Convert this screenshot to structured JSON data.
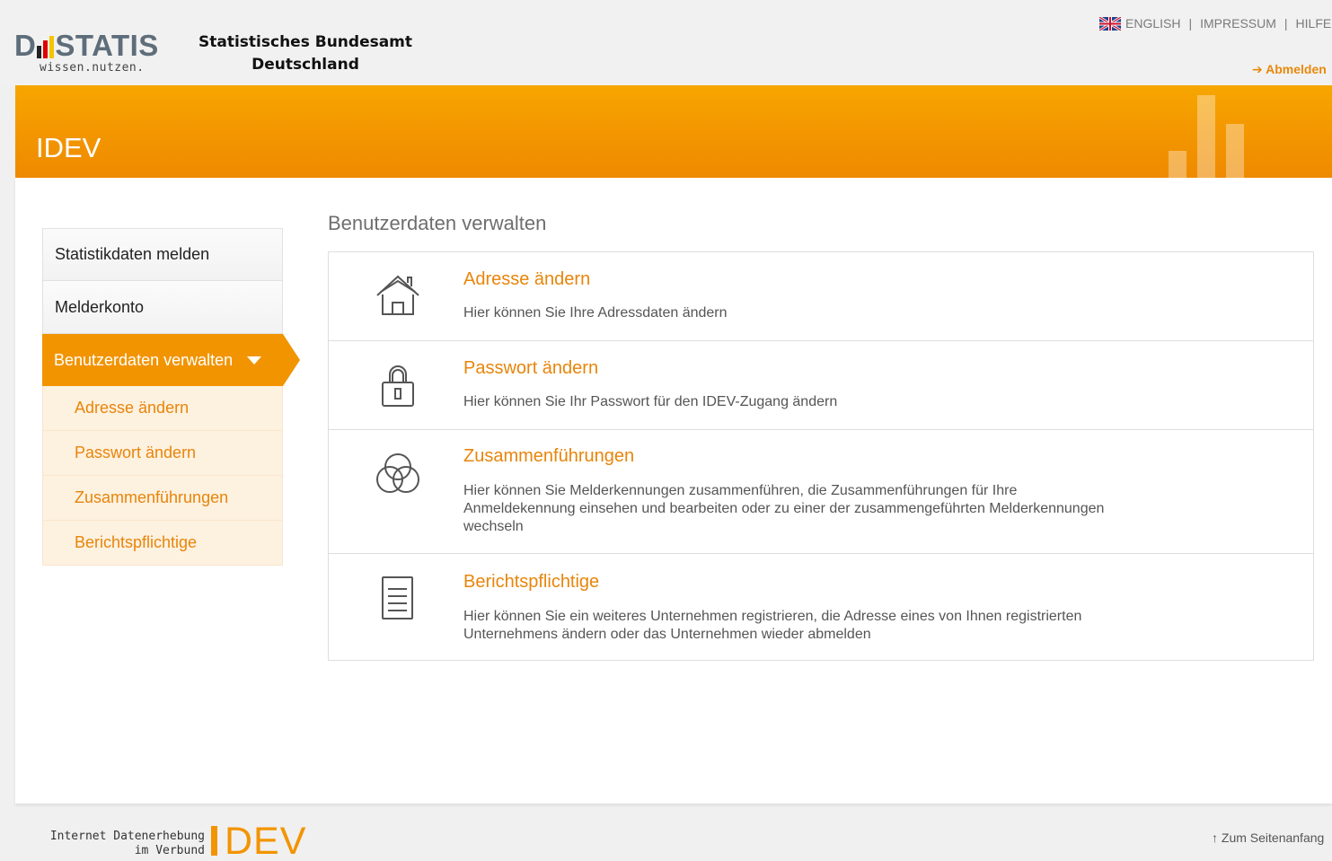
{
  "header": {
    "logo_main_left": "D",
    "logo_main_right": "STATIS",
    "logo_sub": "wissen.nutzen.",
    "org_line1": "Statistisches Bundesamt",
    "org_line2": "Deutschland",
    "links": [
      "ENGLISH",
      "IMPRESSUM",
      "HILFE"
    ],
    "logout": "Abmelden"
  },
  "banner": {
    "title": "IDEV"
  },
  "sidebar": {
    "items": [
      {
        "label": "Statistikdaten melden"
      },
      {
        "label": "Melderkonto"
      }
    ],
    "active": {
      "label": "Benutzerdaten verwalten"
    },
    "subitems": [
      {
        "label": "Adresse ändern"
      },
      {
        "label": "Passwort ändern"
      },
      {
        "label": "Zusammenführungen"
      },
      {
        "label": "Berichtspflichtige"
      }
    ]
  },
  "main": {
    "title": "Benutzerdaten verwalten",
    "rows": [
      {
        "icon": "house-icon",
        "title": "Adresse ändern",
        "desc": "Hier können Sie Ihre Adressdaten ändern"
      },
      {
        "icon": "lock-icon",
        "title": "Passwort ändern",
        "desc": "Hier können Sie Ihr Passwort für den IDEV-Zugang ändern"
      },
      {
        "icon": "circles-icon",
        "title": "Zusammenführungen",
        "desc": "Hier können Sie Melderkennungen zusammenführen, die Zusammenführungen für Ihre Anmeldekennung einsehen und bearbeiten oder zu einer der zusammengeführten Melderkennungen wechseln"
      },
      {
        "icon": "document-icon",
        "title": "Berichtspflichtige",
        "desc": "Hier können Sie ein weiteres Unternehmen registrieren, die Adresse eines von Ihnen registrierten Unternehmens ändern oder das Unternehmen wieder abmelden"
      }
    ]
  },
  "footer": {
    "text_line1": "Internet Datenerhebung",
    "text_line2": "im Verbund",
    "logo": "DEV",
    "totop": "Zum Seitenanfang"
  },
  "colors": {
    "accent": "#f29400",
    "link": "#e8850a"
  }
}
